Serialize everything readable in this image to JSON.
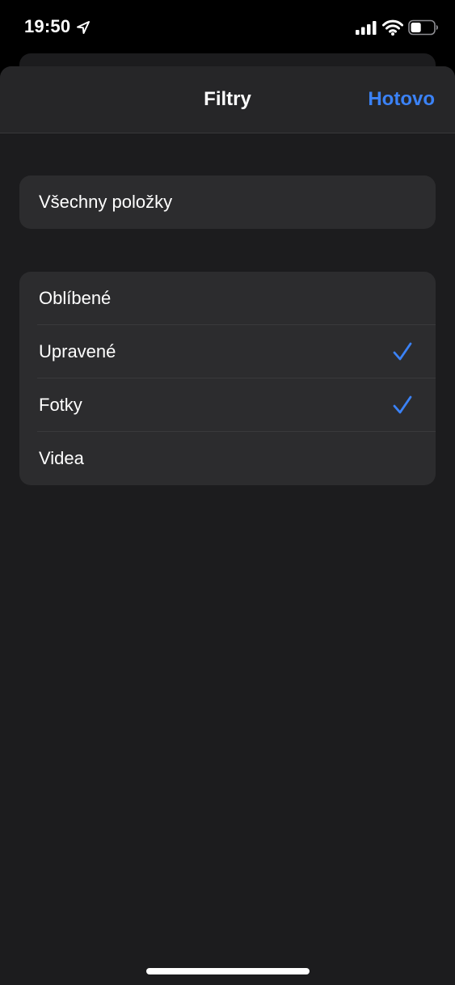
{
  "status_bar": {
    "time": "19:50",
    "icons": [
      "location-arrow-icon",
      "cellular-signal-icon",
      "wifi-icon",
      "battery-icon"
    ],
    "battery_level": 0.45
  },
  "sheet": {
    "title": "Filtry",
    "done_label": "Hotovo",
    "accent_color": "#3b82f6"
  },
  "all_items": {
    "label": "Všechny položky"
  },
  "filters": [
    {
      "label": "Oblíbené",
      "checked": false
    },
    {
      "label": "Upravené",
      "checked": true
    },
    {
      "label": "Fotky",
      "checked": true
    },
    {
      "label": "Videa",
      "checked": false
    }
  ]
}
